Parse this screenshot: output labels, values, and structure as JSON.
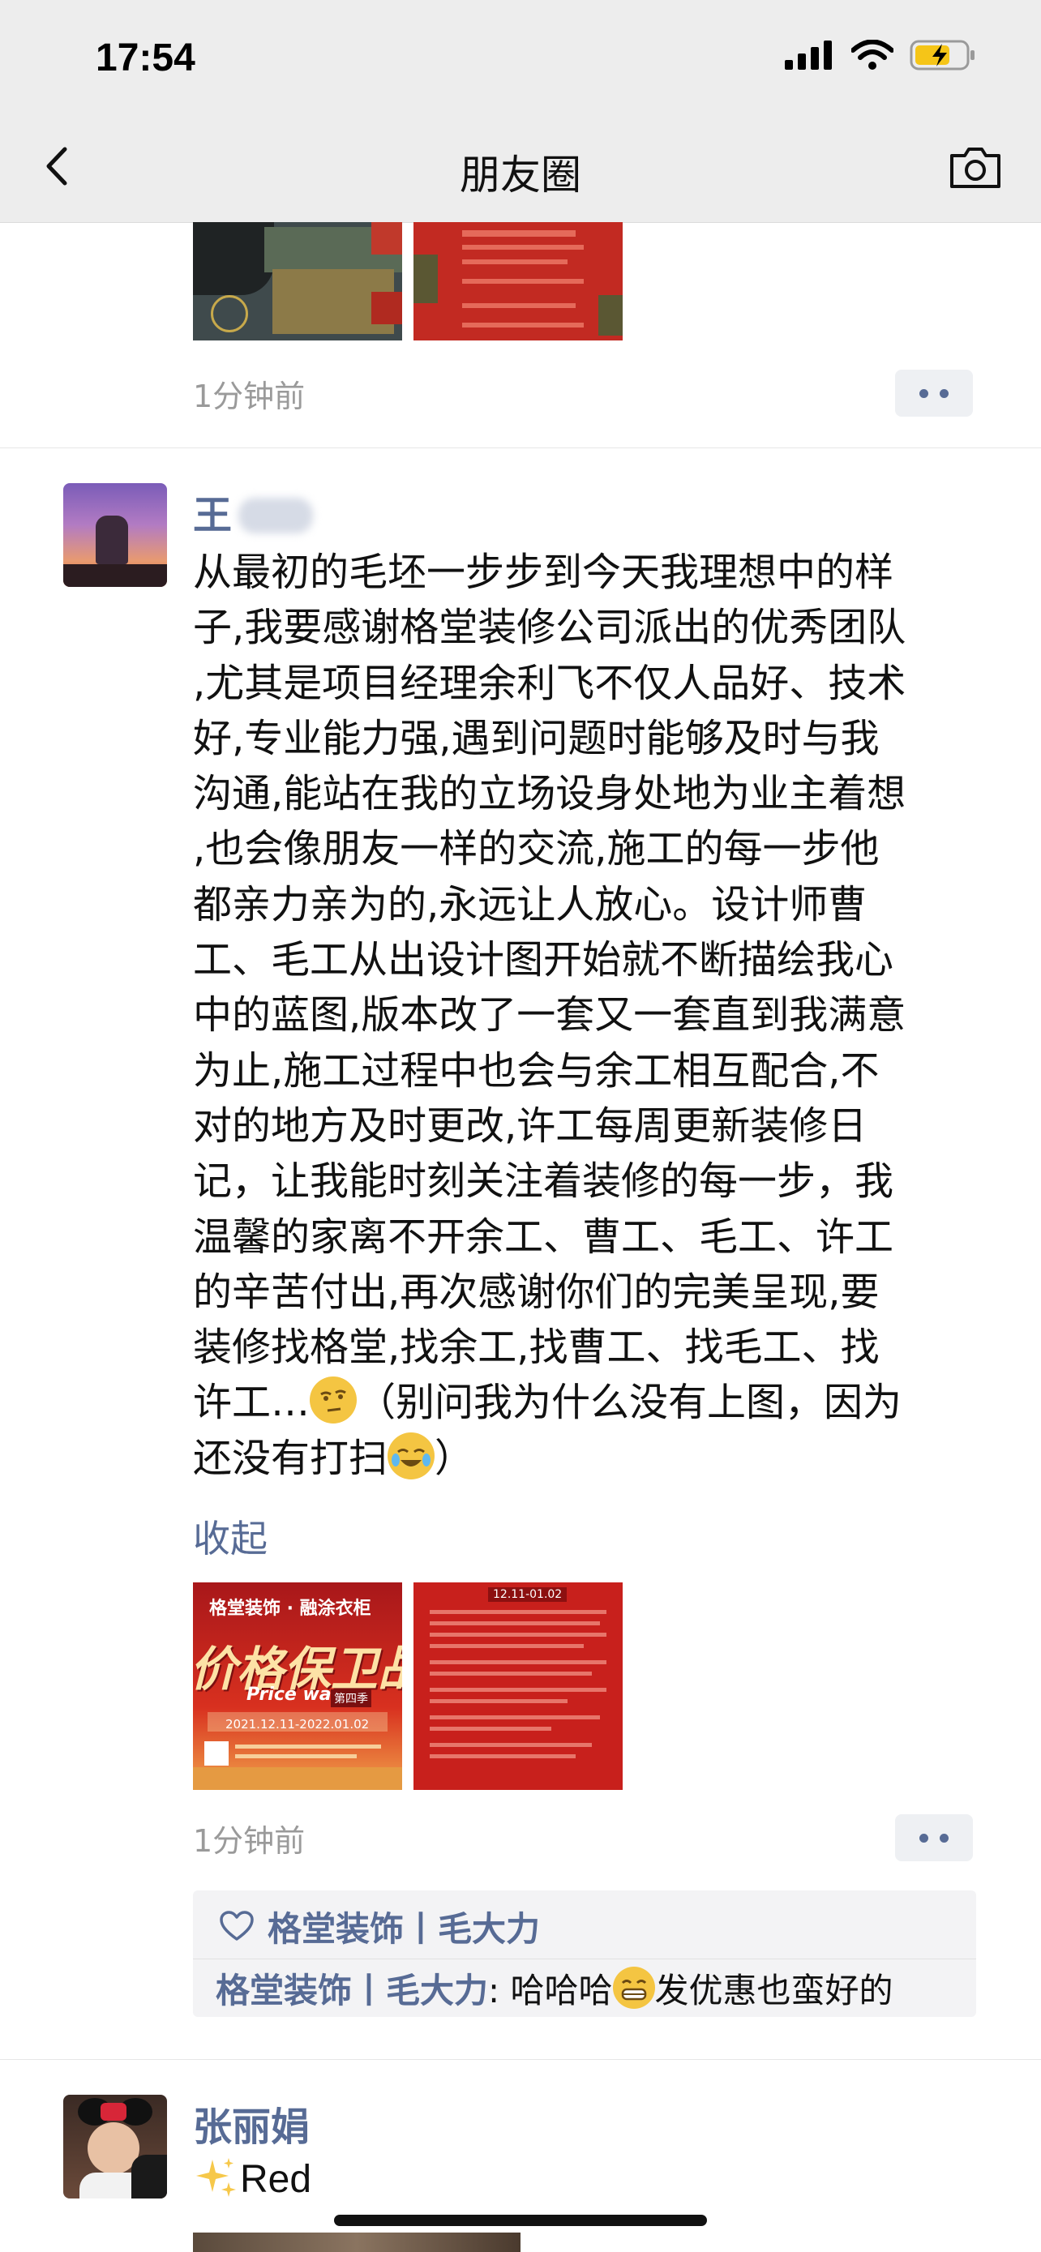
{
  "status_bar": {
    "time": "17:54"
  },
  "nav": {
    "title": "朋友圈"
  },
  "posts": [
    {
      "time_ago": "1分钟前"
    },
    {
      "author": "王",
      "text_lines": [
        "从最初的毛坯一步步到今天我理想中的样",
        "子,我要感谢格堂装修公司派出的优秀团队",
        ",尤其是项目经理余利飞不仅人品好、技术",
        "好,专业能力强,遇到问题时能够及时与我",
        "沟通,能站在我的立场设身处地为业主着想",
        ",也会像朋友一样的交流,施工的每一步他",
        "都亲力亲为的,永远让人放心。设计师曹",
        "工、毛工从出设计图开始就不断描绘我心",
        "中的蓝图,版本改了一套又一套直到我满意",
        "为止,施工过程中也会与余工相互配合,不",
        "对的地方及时更改,许工每周更新装修日",
        "记，让我能时刻关注着装修的每一步，我",
        "温馨的家离不开余工、曹工、毛工、许工",
        "的辛苦付出,再次感谢你们的完美呈现,要",
        "装修找格堂,找余工,找曹工、找毛工、找"
      ],
      "text_line_16_a": "许工…",
      "text_line_16_b": "（别问我为什么没有上图，因为",
      "text_line_17_a": "还没有打扫",
      "text_line_17_b": "）",
      "fold_label": "收起",
      "images": [
        {
          "brand": "格堂装饰 · 融涂衣柜",
          "headline": "价格保卫战",
          "sub": "Price war",
          "badge": "第四季",
          "date": "2021.12.11-2022.01.02"
        },
        {
          "date": "12.11-01.02"
        }
      ],
      "time_ago": "1分钟前",
      "like_name": "格堂装饰丨毛大力",
      "comment_author": "格堂装饰丨毛大力",
      "comment_text_a": ": 哈哈哈",
      "comment_text_b": "发优惠也蛮好的"
    },
    {
      "author": "张丽娟",
      "text": "Red"
    }
  ],
  "colors": {
    "link": "#576b95",
    "bar_bg": "#ededed",
    "poster_red": "#c8201c"
  }
}
